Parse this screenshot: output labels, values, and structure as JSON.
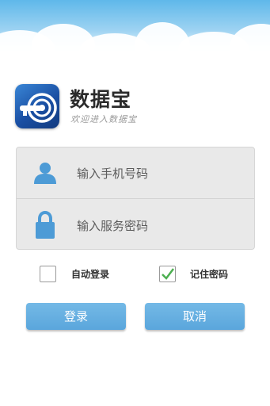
{
  "app": {
    "name": "数据宝",
    "tagline": "欢迎进入数据宝"
  },
  "login_form": {
    "phone_placeholder": "输入手机号码",
    "phone_value": "",
    "password_placeholder": "输入服务密码",
    "password_value": ""
  },
  "options": {
    "auto_login_label": "自动登录",
    "auto_login_checked": false,
    "remember_password_label": "记住密码",
    "remember_password_checked": true
  },
  "buttons": {
    "login_label": "登录",
    "cancel_label": "取消"
  },
  "colors": {
    "accent": "#5aa6dc",
    "icon_blue": "#4d9bd6",
    "check_green": "#4caf50"
  },
  "icons": {
    "user": "user-icon",
    "lock": "lock-icon",
    "logo": "app-logo-icon"
  }
}
